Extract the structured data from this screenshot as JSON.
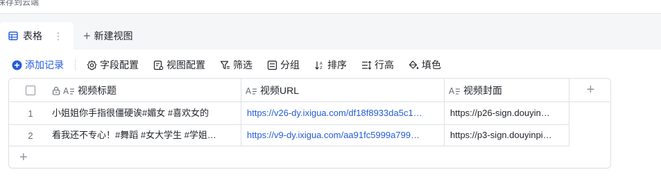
{
  "topbar": {
    "saved_text": "保存到云端"
  },
  "tabs": {
    "active": {
      "label": "表格",
      "more": "⋮"
    },
    "new_view": {
      "plus": "+",
      "label": "新建视图"
    }
  },
  "toolbar": {
    "add_record": "添加记录",
    "field_config": "字段配置",
    "view_config": "视图配置",
    "filter": "筛选",
    "group": "分组",
    "sort": "排序",
    "row_height": "行高",
    "fill_color": "填色"
  },
  "table": {
    "columns": [
      {
        "label": "视频标题",
        "type_icon": "text-field-icon",
        "locked": true
      },
      {
        "label": "视频URL",
        "type_icon": "text-field-icon"
      },
      {
        "label": "视频封面",
        "type_icon": "text-field-icon"
      }
    ],
    "add_column": "+",
    "add_row": "+",
    "rows": [
      {
        "num": "1",
        "title": "小姐姐你手指很僵硬诶#媚女 #喜欢女的",
        "url": "https://v26-dy.ixigua.com/df18f8933da5c1…",
        "cover": "https://p26-sign.douyin…"
      },
      {
        "num": "2",
        "title": "看我还不专心！#舞蹈 #女大学生 #学姐…",
        "url": "https://v9-dy.ixigua.com/aa91fc5999a799…",
        "cover": "https://p3-sign.douyinpi…"
      }
    ]
  },
  "colors": {
    "accent": "#245bdb",
    "border": "#dee0e3",
    "muted": "#646a73"
  }
}
